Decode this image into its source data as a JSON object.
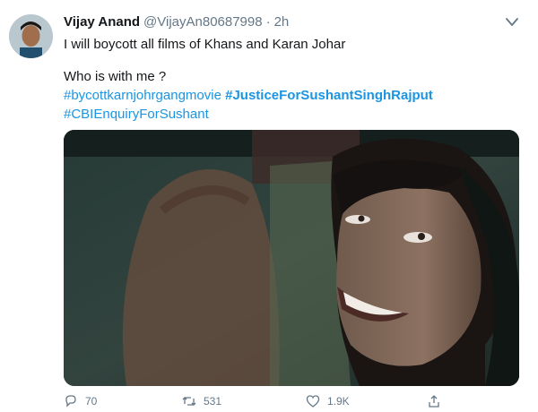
{
  "tweet": {
    "author_name": "Vijay Anand",
    "handle": "@VijayAn80687998",
    "separator": "·",
    "time": "2h",
    "line1": "I will boycott all films of Khans and Karan Johar",
    "line2": "Who is with me ?",
    "hashtags": [
      "#bycottkarnjohrgangmovie",
      "#JusticeForSushantSinghRajput",
      "#CBIEnquiryForSushant"
    ]
  },
  "actions": {
    "reply_count": "70",
    "retweet_count": "531",
    "like_count": "1.9K"
  },
  "colors": {
    "link": "#1b95e0",
    "muted": "#657786",
    "text": "#14171a"
  },
  "icons": [
    "caret-down-icon",
    "reply-icon",
    "retweet-icon",
    "like-icon",
    "share-icon"
  ]
}
